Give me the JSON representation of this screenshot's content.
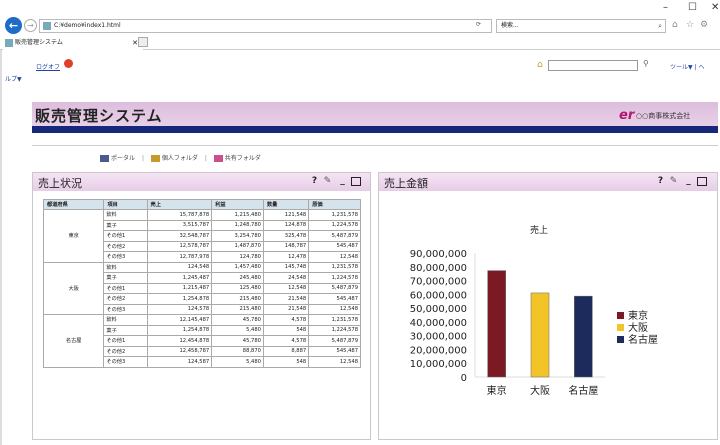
{
  "browser": {
    "url": "C:¥demo¥index1.html",
    "search_placeholder": "検索...",
    "tab_title": "販売管理システム",
    "refresh": "⟳",
    "dropdown": "▾",
    "min": "–",
    "max": "☐",
    "close": "✕"
  },
  "toolbar": {
    "logout": "ログオフ",
    "help_menu": "ルプ▼",
    "tool_menu": "ツール▼ | ヘ",
    "portal_links": [
      "ポータル",
      "個人フォルダ",
      "共有フォルダ"
    ]
  },
  "header": {
    "title": "販売管理システム",
    "logo": "er",
    "company": "○○商事株式会社",
    "colors": {
      "bar": "#17287a",
      "band": "#dcbddc"
    }
  },
  "panel_sales": {
    "title": "売上状況",
    "help": "?",
    "columns": [
      "都道府県",
      "項目",
      "売上",
      "利益",
      "数量",
      "原価"
    ],
    "groups": [
      {
        "pref": "東京",
        "rows": [
          [
            "飲料",
            "15,787,878",
            "1,215,480",
            "121,548",
            "1,231,578"
          ],
          [
            "菓子",
            "3,515,787",
            "1,248,780",
            "124,878",
            "1,224,578"
          ],
          [
            "その他1",
            "32,548,787",
            "3,254,780",
            "325,478",
            "5,487,879"
          ],
          [
            "その他2",
            "12,578,787",
            "1,487,870",
            "148,787",
            "545,487"
          ],
          [
            "その他3",
            "12,787,978",
            "124,780",
            "12,478",
            "12,548"
          ]
        ]
      },
      {
        "pref": "大阪",
        "rows": [
          [
            "飲料",
            "124,548",
            "1,457,480",
            "145,748",
            "1,231,578"
          ],
          [
            "菓子",
            "1,245,487",
            "245,480",
            "24,548",
            "1,224,578"
          ],
          [
            "その他1",
            "1,215,487",
            "125,480",
            "12,548",
            "5,487,879"
          ],
          [
            "その他2",
            "1,254,878",
            "215,480",
            "21,548",
            "545,487"
          ],
          [
            "その他3",
            "124,578",
            "215,480",
            "21,548",
            "12,548"
          ]
        ]
      },
      {
        "pref": "名古屋",
        "rows": [
          [
            "飲料",
            "12,145,487",
            "45,780",
            "4,578",
            "1,231,578"
          ],
          [
            "菓子",
            "1,254,878",
            "5,480",
            "548",
            "1,224,578"
          ],
          [
            "その他1",
            "12,454,878",
            "45,780",
            "4,578",
            "5,487,879"
          ],
          [
            "その他2",
            "12,458,787",
            "88,870",
            "8,887",
            "545,487"
          ],
          [
            "その他3",
            "124,587",
            "5,480",
            "548",
            "12,548"
          ]
        ]
      }
    ]
  },
  "panel_amount": {
    "title": "売上金額",
    "help": "?"
  },
  "chart_data": {
    "type": "bar",
    "title": "売上",
    "categories": [
      "東京",
      "大阪",
      "名古屋"
    ],
    "values": [
      77218217,
      61000000,
      58700000
    ],
    "ylim": [
      0,
      90000000
    ],
    "yticks": [
      "90,000,000",
      "80,000,000",
      "70,000,000",
      "60,000,000",
      "50,000,000",
      "40,000,000",
      "30,000,000",
      "20,000,000",
      "10,000,000",
      "0"
    ],
    "colors": [
      "#7b1a22",
      "#f3c428",
      "#1c2b5c"
    ],
    "legend": [
      "東京",
      "大阪",
      "名古屋"
    ],
    "legend_position": "right",
    "grid": false
  }
}
